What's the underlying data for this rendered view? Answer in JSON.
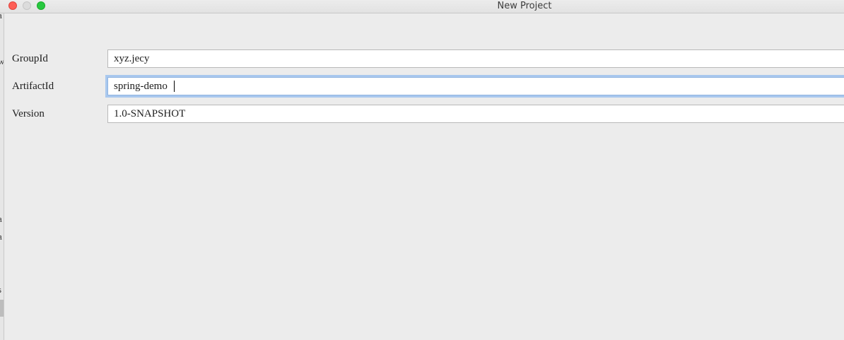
{
  "window": {
    "title": "New Project"
  },
  "backdrop": {
    "fragments": [
      "a",
      "w",
      "a",
      "a",
      "s"
    ]
  },
  "form": {
    "group_id": {
      "label": "GroupId",
      "value": "xyz.jecy"
    },
    "artifact_id": {
      "label": "ArtifactId",
      "value": "spring-demo"
    },
    "version": {
      "label": "Version",
      "value": "1.0-SNAPSHOT"
    }
  },
  "colors": {
    "close": "#fe5f57",
    "zoom": "#28c840",
    "focus_ring": "#a9c8ee"
  }
}
